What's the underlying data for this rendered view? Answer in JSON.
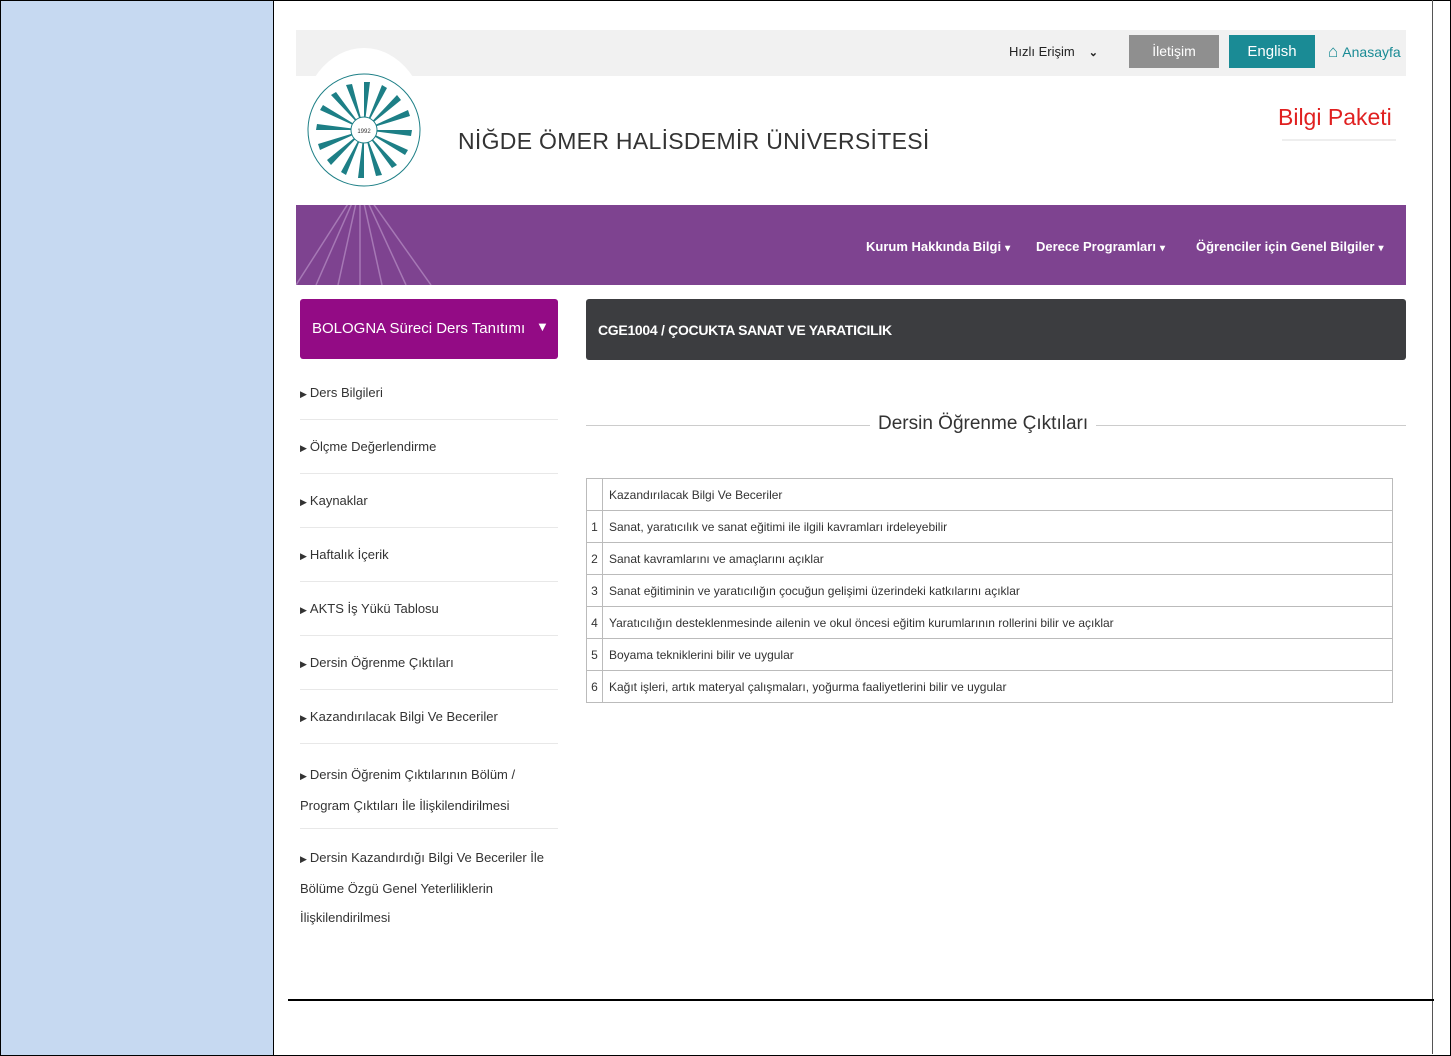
{
  "header": {
    "quick_access": "Hızlı Erişim",
    "contact": "İletişim",
    "english": "English",
    "home": "Anasayfa",
    "university": "NİĞDE ÖMER HALİSDEMİR ÜNİVERSİTESİ",
    "package": "Bilgi Paketi",
    "logo_text": "NİĞDE ÖMER HALİSDEMİR ÜNİVERSİTESİ",
    "logo_year": "1992"
  },
  "nav": {
    "items": [
      "Kurum Hakkında Bilgi",
      "Derece Programları",
      "Öğrenciler için Genel Bilgiler"
    ]
  },
  "sidebar": {
    "title": "BOLOGNA Süreci Ders Tanıtımı",
    "items": [
      "Ders Bilgileri",
      "Ölçme Değerlendirme",
      "Kaynaklar",
      "Haftalık İçerik",
      "AKTS İş Yükü Tablosu",
      "Dersin Öğrenme Çıktıları",
      "Kazandırılacak Bilgi Ve Beceriler",
      "Dersin Öğrenim Çıktılarının Bölüm / Program Çıktıları İle İlişkilendirilmesi",
      "Dersin Kazandırdığı Bilgi Ve Beceriler İle Bölüme Özgü Genel Yeterliliklerin İlişkilendirilmesi"
    ]
  },
  "main": {
    "course_title": "CGE1004 / ÇOCUKTA SANAT VE YARATICILIK",
    "section_title": "Dersin Öğrenme Çıktıları",
    "table_header": "Kazandırılacak Bilgi Ve Beceriler",
    "rows": [
      {
        "no": "1",
        "text": "Sanat, yaratıcılık ve sanat eğitimi ile ilgili kavramları irdeleyebilir"
      },
      {
        "no": "2",
        "text": "Sanat kavramlarını ve amaçlarını açıklar"
      },
      {
        "no": "3",
        "text": "Sanat eğitiminin ve yaratıcılığın çocuğun gelişimi üzerindeki katkılarını açıklar"
      },
      {
        "no": "4",
        "text": "Yaratıcılığın desteklenmesinde ailenin ve okul öncesi eğitim kurumlarının rollerini bilir ve açıklar"
      },
      {
        "no": "5",
        "text": "Boyama tekniklerini bilir ve uygular"
      },
      {
        "no": "6",
        "text": "Kağıt işleri, artık materyal çalışmaları, yoğurma faaliyetlerini bilir ve uygular"
      }
    ]
  },
  "colors": {
    "left_panel": "#c6d9f1",
    "purple_band": "#7e4390",
    "sidebar_head": "#930b85",
    "course_bar": "#3c3d40",
    "english_button": "#1a8b95",
    "package_text": "#e02020"
  }
}
